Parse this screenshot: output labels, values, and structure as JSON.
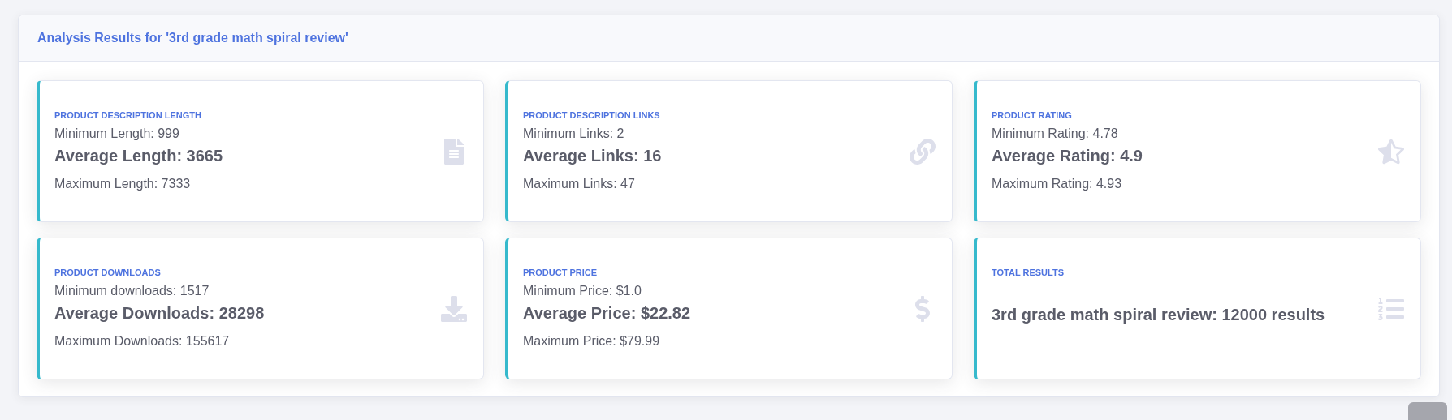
{
  "panel": {
    "title": "Analysis Results for '3rd grade math spiral review'"
  },
  "cards": [
    {
      "kind": "stats",
      "label": "PRODUCT DESCRIPTION LENGTH",
      "minimum": "Minimum Length: 999",
      "average": "Average Length: 3665",
      "maximum": "Maximum Length: 7333"
    },
    {
      "kind": "stats",
      "label": "PRODUCT DESCRIPTION LINKS",
      "minimum": "Minimum Links: 2",
      "average": "Average Links: 16",
      "maximum": "Maximum Links: 47"
    },
    {
      "kind": "stats",
      "label": "PRODUCT RATING",
      "minimum": "Minimum Rating: 4.78",
      "average": "Average Rating: 4.9",
      "maximum": "Maximum Rating: 4.93"
    },
    {
      "kind": "stats",
      "label": "PRODUCT DOWNLOADS",
      "minimum": "Minimum downloads: 1517",
      "average": "Average Downloads: 28298",
      "maximum": "Maximum Downloads: 155617"
    },
    {
      "kind": "stats",
      "label": "PRODUCT PRICE",
      "minimum": "Minimum Price: $1.0",
      "average": "Average Price: $22.82",
      "maximum": "Maximum Price: $79.99"
    },
    {
      "kind": "total",
      "label": "TOTAL RESULTS",
      "total": "3rd grade math spiral review: 12000 results"
    }
  ]
}
